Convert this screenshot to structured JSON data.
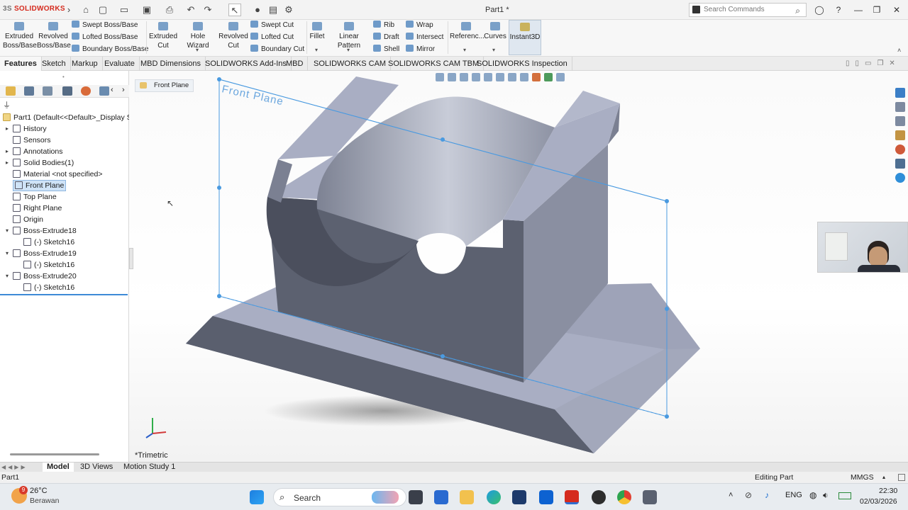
{
  "app": {
    "logo_brand": "SOLIDWORKS",
    "logo_prefix": "3S",
    "doc_title": "Part1 *"
  },
  "search": {
    "placeholder": "Search Commands"
  },
  "ribbon": {
    "extruded_boss": "Extruded\nBoss/Base",
    "revolved_boss": "Revolved\nBoss/Base",
    "swept_boss": "Swept Boss/Base",
    "lofted_boss": "Lofted Boss/Base",
    "boundary_boss": "Boundary Boss/Base",
    "extruded_cut": "Extruded\nCut",
    "hole_wizard": "Hole Wizard",
    "revolved_cut": "Revolved\nCut",
    "swept_cut": "Swept Cut",
    "lofted_cut": "Lofted Cut",
    "boundary_cut": "Boundary Cut",
    "fillet": "Fillet",
    "linear_pattern": "Linear Pattern",
    "rib": "Rib",
    "draft": "Draft",
    "shell": "Shell",
    "wrap": "Wrap",
    "intersect": "Intersect",
    "mirror": "Mirror",
    "reference": "Referenc...",
    "curves": "Curves",
    "instant3d": "Instant3D"
  },
  "tabs": [
    "Features",
    "Sketch",
    "Markup",
    "Evaluate",
    "MBD Dimensions",
    "SOLIDWORKS Add-Ins",
    "MBD",
    "SOLIDWORKS CAM",
    "SOLIDWORKS CAM TBM",
    "SOLIDWORKS Inspection"
  ],
  "tree": {
    "root": "Part1  (Default<<Default>_Display S",
    "items": [
      {
        "label": "History",
        "expand": "▸"
      },
      {
        "label": "Sensors",
        "expand": ""
      },
      {
        "label": "Annotations",
        "expand": "▸"
      },
      {
        "label": "Solid Bodies(1)",
        "expand": "▸"
      },
      {
        "label": "Material <not specified>",
        "expand": ""
      },
      {
        "label": "Front Plane",
        "expand": ""
      },
      {
        "label": "Top Plane",
        "expand": ""
      },
      {
        "label": "Right Plane",
        "expand": ""
      },
      {
        "label": "Origin",
        "expand": ""
      },
      {
        "label": "Boss-Extrude18",
        "expand": "▾"
      },
      {
        "label": "(-) Sketch16",
        "expand": ""
      },
      {
        "label": "Boss-Extrude19",
        "expand": "▾"
      },
      {
        "label": "(-) Sketch16",
        "expand": ""
      },
      {
        "label": "Boss-Extrude20",
        "expand": "▾"
      },
      {
        "label": "(-) Sketch16",
        "expand": ""
      }
    ]
  },
  "viewport": {
    "breadcrumb": "Front Plane",
    "plane_label": "Front Plane",
    "view_name": "*Trimetric"
  },
  "bottom_tabs": [
    "Model",
    "3D Views",
    "Motion Study 1"
  ],
  "status": {
    "left": "Part1",
    "mode": "Editing Part",
    "units": "MMGS"
  },
  "taskbar": {
    "weather_temp": "26°C",
    "weather_desc": "Berawan",
    "weather_badge": "9",
    "search_label": "Search",
    "lang": "ENG",
    "time": "22:30",
    "date": "02/03/2026"
  },
  "colors": {
    "accent": "#0a78d7",
    "plane": "#4a9ae0",
    "model_face": "#a9aec3",
    "model_dark": "#5a5f6e"
  }
}
